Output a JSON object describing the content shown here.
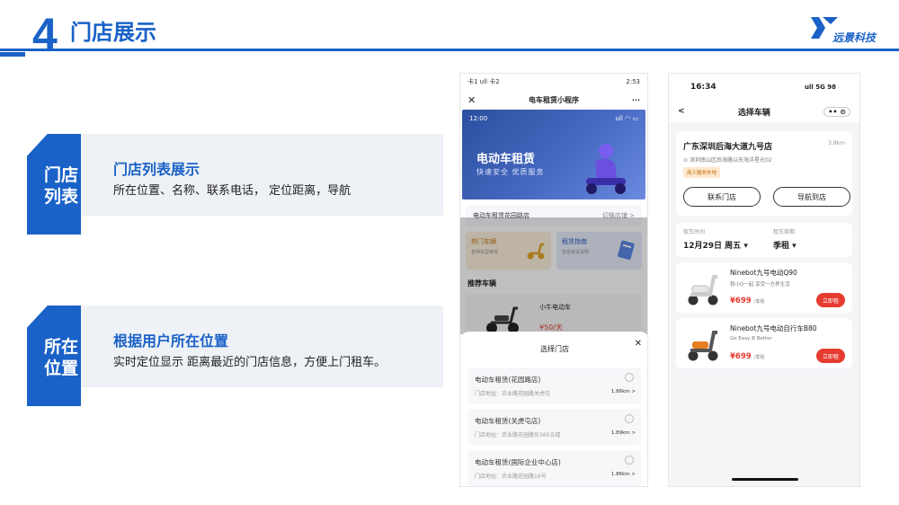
{
  "header": {
    "number": "4",
    "title": "门店展示"
  },
  "logo": {
    "text": "远景科技"
  },
  "features": [
    {
      "tab": [
        "门店",
        "列表"
      ],
      "title": "门店列表展示",
      "desc": "所在位置、名称、联系电话， 定位距离，导航"
    },
    {
      "tab": [
        "所在",
        "位置"
      ],
      "title": "根据用户所在位置",
      "desc": "实时定位显示 距离最近的门店信息，方便上门租车。"
    }
  ],
  "phone1": {
    "status_time": "2:53",
    "status_left": "卡1 ull 卡2",
    "nav": {
      "close": "✕",
      "title": "电车租赁小程序",
      "more": "···"
    },
    "banner": {
      "time": "12:00",
      "icons": "ull ◠ ▭",
      "headline": "电动车租赁",
      "tagline": "快速安全 优质服务"
    },
    "store_row": {
      "name": "电动车租赁花园路店",
      "switch": "切换店铺 >"
    },
    "cards": [
      {
        "title": "热门车辆",
        "sub": "各种车型推荐"
      },
      {
        "title": "租赁指南",
        "sub": "查看租赁说明"
      }
    ],
    "rec_title": "推荐车辆",
    "vehicle": {
      "name": "小牛电动车",
      "price": "¥50/天"
    },
    "sheet": {
      "title": "选择门店",
      "close": "✕",
      "stores": [
        {
          "name": "电动车租赁(花园路店)",
          "address": "门店地址：农业路花园路关虎屯",
          "distance": "1.86km >"
        },
        {
          "name": "电动车租赁(关虎屯店)",
          "address": "门店地址：农业路花园路东360五楼",
          "distance": "1.89km >"
        },
        {
          "name": "电动车租赁(国际企业中心店)",
          "address": "门店地址：农业路花园路16号",
          "distance": "1.86km >"
        }
      ]
    }
  },
  "phone2": {
    "status_time": "16:34",
    "status_right": "ull 5G 98",
    "nav": {
      "back": "<",
      "title": "选择车辆",
      "capsule": "•• ⊙"
    },
    "store": {
      "name": "广东深圳后海大道九号店",
      "distance": "3.8km",
      "address": "深圳南山区后海路以东海洋星光02",
      "badge": "商人服务外地",
      "btn_contact": "联系门店",
      "btn_nav": "导航到店"
    },
    "date": {
      "label_time": "取车时间",
      "value_time": "12月29日 周五 ▾",
      "label_period": "租车周期",
      "value_period": "季租 ▾"
    },
    "vehicles": [
      {
        "name": "Ninebot九号电动Q90",
        "desc": "和小Q一起 享受一方养生活",
        "price": "¥699",
        "unit": "/季租",
        "btn": "立即租"
      },
      {
        "name": "Ninebot九号电动自行车B80",
        "desc": "Go Easy B Better",
        "price": "¥699",
        "unit": "/季租",
        "btn": "立即租"
      }
    ]
  },
  "colors": {
    "brand": "#1a62c8",
    "accent_red": "#e63b2f"
  }
}
